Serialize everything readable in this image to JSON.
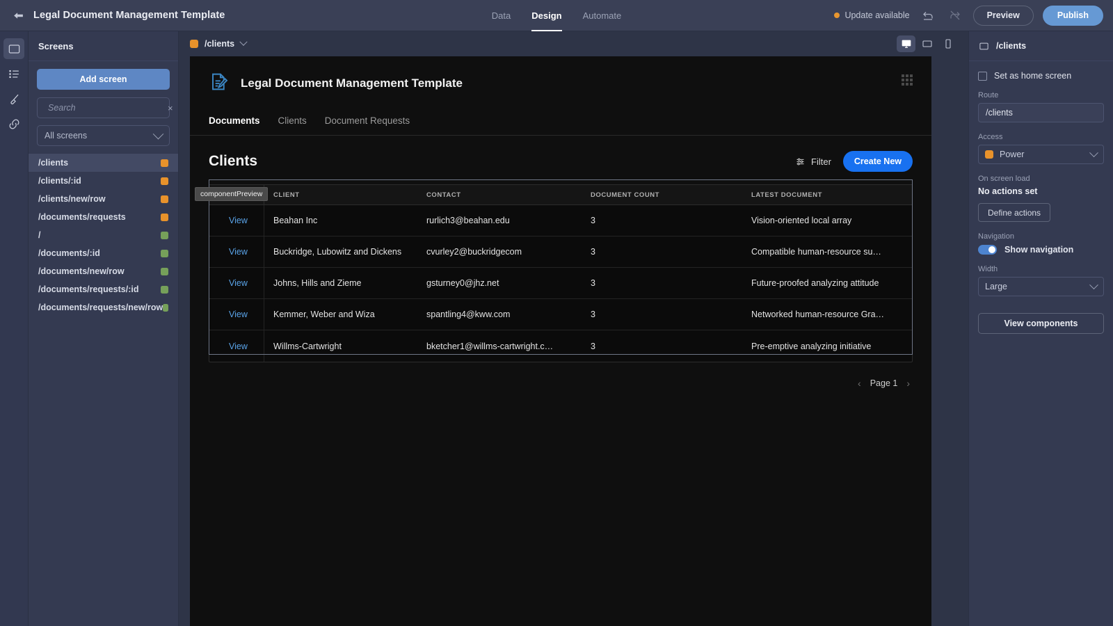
{
  "topbar": {
    "back_icon": "back-arrow-icon",
    "title": "Legal Document Management Template",
    "tabs": [
      {
        "label": "Data",
        "active": false
      },
      {
        "label": "Design",
        "active": true
      },
      {
        "label": "Automate",
        "active": false
      }
    ],
    "update_text": "Update available",
    "update_dot_color": "#e8962f",
    "undo_icon": "undo-icon",
    "redo_icon": "redo-disabled-icon",
    "preview_label": "Preview",
    "publish_label": "Publish",
    "publish_color": "#6699d4"
  },
  "rail": {
    "items": [
      {
        "name": "screens-icon",
        "active": true
      },
      {
        "name": "layers-list-icon",
        "active": false
      },
      {
        "name": "theme-brush-icon",
        "active": false
      },
      {
        "name": "links-icon",
        "active": false
      }
    ]
  },
  "screens_panel": {
    "header": "Screens",
    "add_button": "Add screen",
    "search_placeholder": "Search",
    "search_value": "",
    "clear_icon": "×",
    "filter_label": "All screens",
    "items": [
      {
        "route": "/clients",
        "color": "#e8922b",
        "active": true
      },
      {
        "route": "/clients/:id",
        "color": "#e8922b",
        "active": false
      },
      {
        "route": "/clients/new/row",
        "color": "#e8922b",
        "active": false
      },
      {
        "route": "/documents/requests",
        "color": "#e8922b",
        "active": false
      },
      {
        "route": "/",
        "color": "#76a05a",
        "active": false
      },
      {
        "route": "/documents/:id",
        "color": "#76a05a",
        "active": false
      },
      {
        "route": "/documents/new/row",
        "color": "#76a05a",
        "active": false
      },
      {
        "route": "/documents/requests/:id",
        "color": "#76a05a",
        "active": false
      },
      {
        "route": "/documents/requests/new/row",
        "color": "#76a05a",
        "active": false
      }
    ]
  },
  "canvas_bar": {
    "breadcrumb_route": "/clients",
    "breadcrumb_color": "#e8922b",
    "devices": [
      {
        "name": "desktop-view-button",
        "active": true
      },
      {
        "name": "tablet-view-button",
        "active": false
      },
      {
        "name": "mobile-view-button",
        "active": false
      }
    ]
  },
  "preview": {
    "brand_title": "Legal Document Management Template",
    "logo_icon": "document-pencil-icon",
    "logo_color": "#3b86c4",
    "drag_handle_icon": "grid-dots-icon",
    "nav": [
      {
        "label": "Documents",
        "active": true
      },
      {
        "label": "Clients",
        "active": false
      },
      {
        "label": "Document Requests",
        "active": false
      }
    ],
    "tooltip": "componentPreview",
    "table": {
      "title": "Clients",
      "filter_label": "Filter",
      "filter_icon": "sliders-icon",
      "create_label": "Create New",
      "create_color": "#1871f0",
      "columns": [
        "",
        "CLIENT",
        "CONTACT",
        "DOCUMENT COUNT",
        "LATEST DOCUMENT"
      ],
      "view_label": "View",
      "rows": [
        {
          "view": "View",
          "client": "Beahan Inc",
          "contact": "rurlich3@beahan.edu",
          "count": "3",
          "latest": "Vision-oriented local array"
        },
        {
          "view": "View",
          "client": "Buckridge, Lubowitz and Dickens",
          "contact": "cvurley2@buckridgecom",
          "count": "3",
          "latest": "Compatible human-resource su…"
        },
        {
          "view": "View",
          "client": "Johns, Hills and Zieme",
          "contact": "gsturney0@jhz.net",
          "count": "3",
          "latest": "Future-proofed analyzing attitude"
        },
        {
          "view": "View",
          "client": "Kemmer, Weber and Wiza",
          "contact": "spantling4@kww.com",
          "count": "3",
          "latest": "Networked human-resource Gra…"
        },
        {
          "view": "View",
          "client": "Willms-Cartwright",
          "contact": "bketcher1@willms-cartwright.c…",
          "count": "3",
          "latest": "Pre-emptive analyzing initiative"
        }
      ],
      "pagination": {
        "prev": "‹",
        "page": "Page 1",
        "next": "›"
      }
    }
  },
  "right_panel": {
    "header_title": "/clients",
    "header_icon": "screen-icon",
    "home_checkbox_label": "Set as home screen",
    "home_checked": false,
    "route_label": "Route",
    "route_value": "/clients",
    "access_label": "Access",
    "access_value": "Power",
    "access_color": "#e8922b",
    "onload_label": "On screen load",
    "onload_value": "No actions set",
    "define_actions_label": "Define actions",
    "navigation_label": "Navigation",
    "show_nav_label": "Show navigation",
    "show_nav_on": true,
    "width_label": "Width",
    "width_value": "Large",
    "view_components_label": "View components"
  }
}
